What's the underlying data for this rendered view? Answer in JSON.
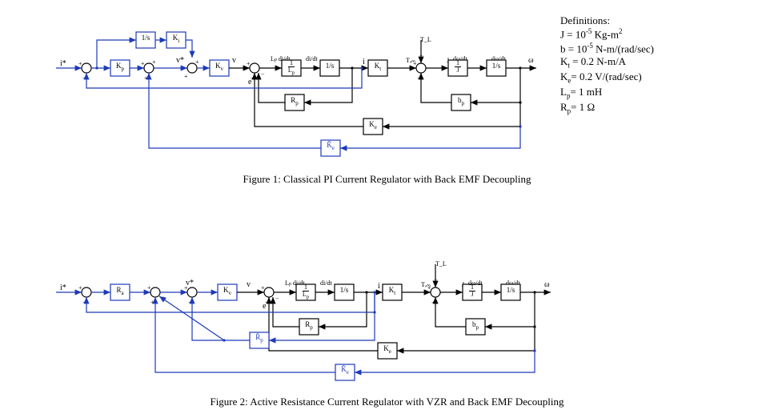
{
  "figures": [
    {
      "caption": "Figure 1:  Classical PI Current Regulator with Back EMF Decoupling"
    },
    {
      "caption": "Figure 2:  Active Resistance Current Regulator with VZR and Back EMF Decoupling"
    }
  ],
  "definitions": {
    "title": "Definitions:",
    "items": [
      "J  = 10<sup>-5</sup> Kg-m<sup>2</sup>",
      "b  = 10<sup>-5</sup> N-m/(rad/sec)",
      "K<sub>t</sub> = 0.2 N-m/A",
      "K<sub>e</sub>= 0.2 V/(rad/sec)",
      "L<sub>p</sub>= 1 mH",
      "R<sub>p</sub>= 1 Ω"
    ]
  },
  "blocks": {
    "one_s": "1/s",
    "Ki": "K<sub>i</sub>",
    "Kp": "K<sub>p</sub>",
    "Kv": "K<sub>v</sub>",
    "Ra": "R<sub>a</sub>",
    "one_Lp": "1/L<sub>p</sub>",
    "Kt": "K<sub>t</sub>",
    "Rp": "R<sub>p</sub>",
    "Rph": "R̂<sub>p</sub>",
    "bp": "b<sub>p</sub>",
    "Ke": "K<sub>e</sub>",
    "Keh": "K̂<sub>e</sub>",
    "one_J": "1/J"
  },
  "signals": {
    "istar": "i*",
    "vstar": "v*",
    "v": "v",
    "e": "e",
    "i": "i",
    "Tem": "T<sub>em</sub>",
    "TL": "T<sub>L</sub>",
    "J": "J",
    "omega": "ω",
    "Lp_didt": "L<sub>p</sub> di/dt",
    "didt": "di/dt",
    "dwdt": "dω/dt"
  }
}
